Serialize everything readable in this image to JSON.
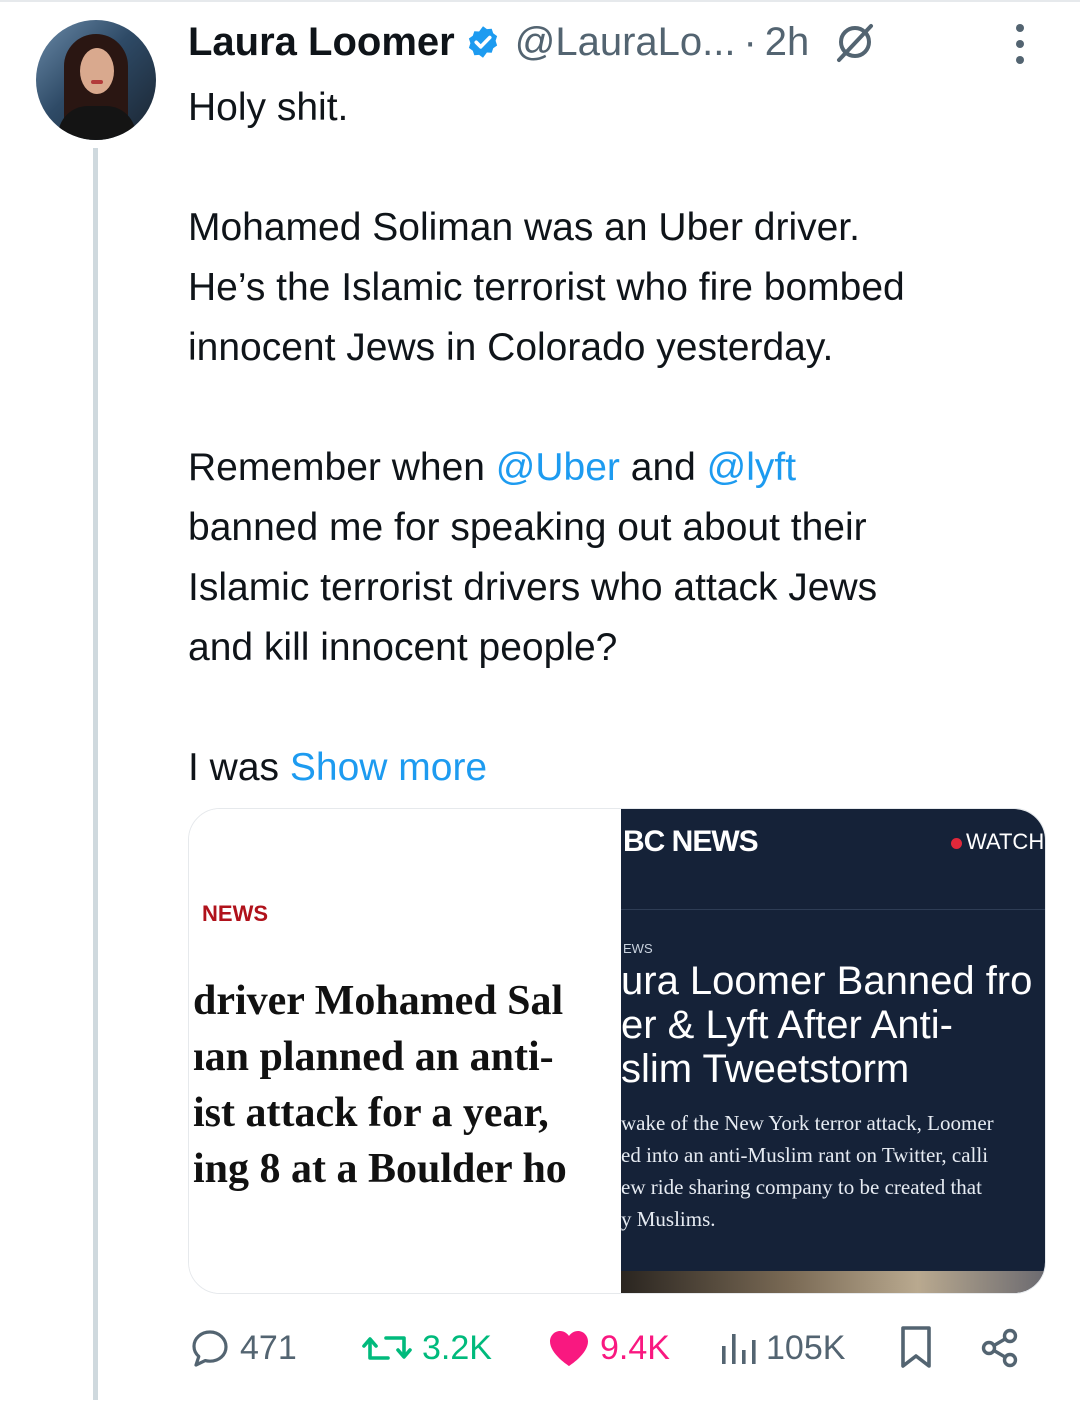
{
  "author": {
    "name": "Laura Loomer",
    "handle": "@LauraLo...",
    "separator": "·",
    "time": "2h"
  },
  "icons": {
    "verified": "verified-badge-icon",
    "grok": "grok-icon",
    "more": "more-options-icon",
    "reply": "reply-icon",
    "repost": "repost-icon",
    "like": "like-heart-icon",
    "views": "views-chart-icon",
    "bookmark": "bookmark-icon",
    "share": "share-icon"
  },
  "colors": {
    "link": "#1d9bf0",
    "verified": "#1d9bf0",
    "repost": "#00ba7c",
    "like": "#f91880",
    "muted": "#536471"
  },
  "tweet": {
    "line1": "Holy shit.",
    "para2_line1": "Mohamed Soliman was an Uber driver.",
    "para2_line2": "He’s the Islamic terrorist who fire bombed",
    "para2_line3": "innocent Jews in Colorado yesterday.",
    "para3_prefix": "Remember when ",
    "mention_uber": "@Uber",
    "para3_and": " and ",
    "mention_lyft": "@lyft",
    "para3_line2": "banned me for speaking out about their",
    "para3_line3": "Islamic terrorist drivers who attack Jews",
    "para3_line4": "and kill innocent people?",
    "para4_prefix": "I was ",
    "show_more": "Show more"
  },
  "media": {
    "left": {
      "source": "NEWS",
      "headline": [
        "driver Mohamed Sal",
        "ıan planned an anti-",
        "ist attack for a year,",
        "ing 8 at a Boulder ho"
      ]
    },
    "right": {
      "brand": "BC NEWS",
      "watch": "WATCH",
      "section": "EWS",
      "title": [
        "ura Loomer Banned fro",
        "er & Lyft After Anti-",
        "slim Tweetstorm"
      ],
      "description": [
        "wake of the New York terror attack, Loomer",
        "ed into an anti-Muslim rant on Twitter, calli",
        "ew ride sharing company to be created that",
        "y Muslims."
      ]
    }
  },
  "actions": {
    "replies": "471",
    "reposts": "3.2K",
    "likes": "9.4K",
    "views": "105K"
  }
}
